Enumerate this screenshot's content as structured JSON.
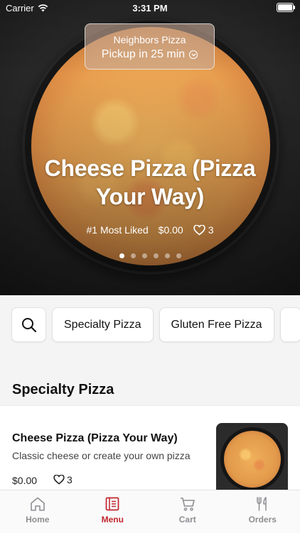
{
  "status_bar": {
    "carrier": "Carrier",
    "time": "3:31 PM"
  },
  "store": {
    "name": "Neighbors Pizza",
    "pickup": "Pickup in 25 min"
  },
  "hero": {
    "title": "Cheese Pizza (Pizza Your Way)",
    "rank": "#1 Most Liked",
    "price": "$0.00",
    "likes": "3",
    "slides_total": 6,
    "active_slide": 1
  },
  "chips": {
    "items": [
      "Specialty Pizza",
      "Gluten Free Pizza"
    ]
  },
  "section": {
    "title": "Specialty Pizza"
  },
  "item": {
    "name": "Cheese Pizza (Pizza Your Way)",
    "description": "Classic cheese or create your own pizza",
    "price": "$0.00",
    "likes": "3"
  },
  "tabs": [
    {
      "label": "Home",
      "icon": "home-icon"
    },
    {
      "label": "Menu",
      "icon": "menu-icon"
    },
    {
      "label": "Cart",
      "icon": "cart-icon"
    },
    {
      "label": "Orders",
      "icon": "orders-icon"
    }
  ],
  "colors": {
    "accent": "#c0262d",
    "inactive_tab": "#8e8e93"
  }
}
